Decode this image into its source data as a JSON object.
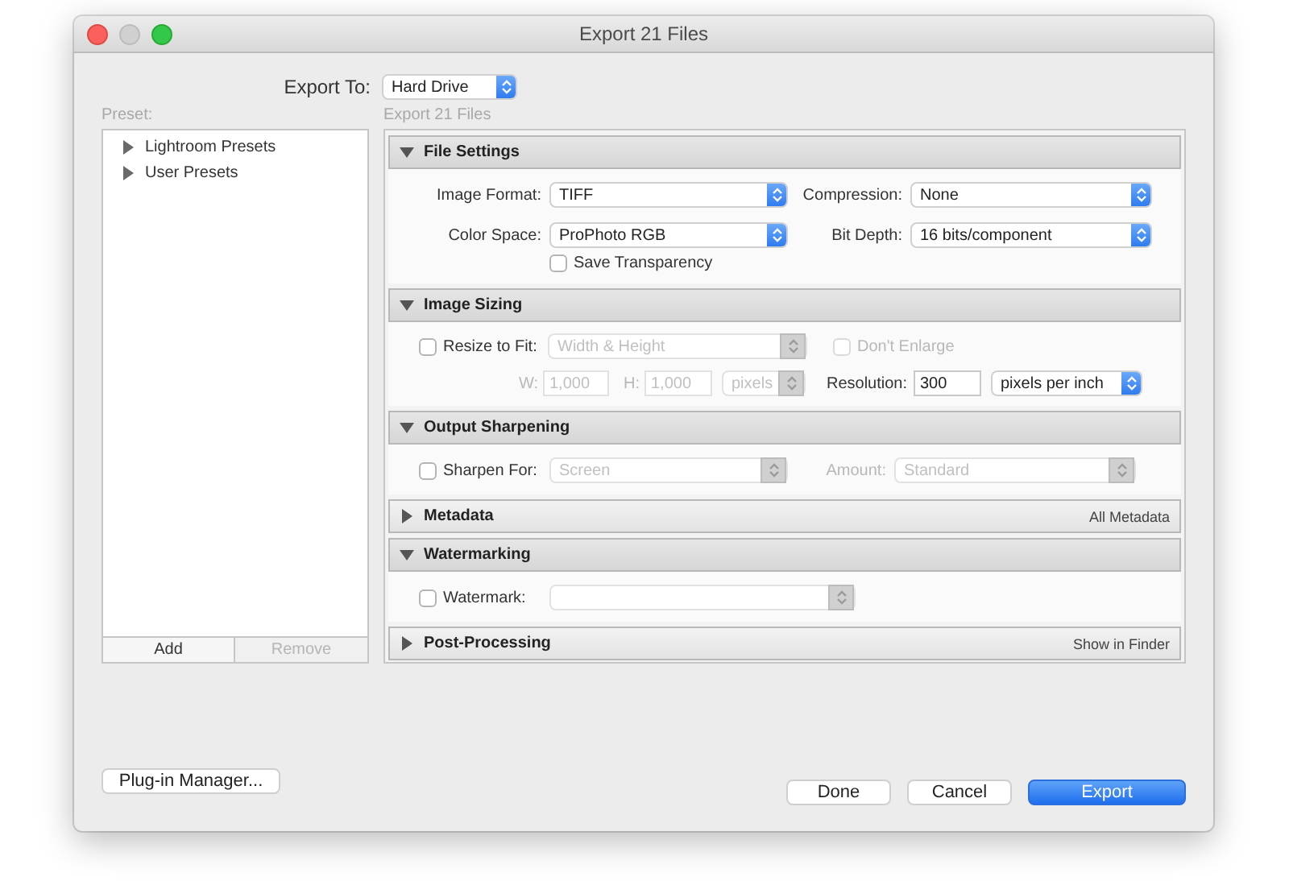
{
  "window": {
    "title": "Export 21 Files"
  },
  "export_to": {
    "label": "Export To:",
    "value": "Hard Drive"
  },
  "presets": {
    "label": "Preset:",
    "items": [
      {
        "label": "Lightroom Presets",
        "expanded": false
      },
      {
        "label": "User Presets",
        "expanded": false
      }
    ],
    "buttons": [
      {
        "label": "Add",
        "disabled": false
      },
      {
        "label": "Remove",
        "disabled": true
      }
    ]
  },
  "subtitle": "Export 21 Files",
  "file_settings": {
    "title": "File Settings",
    "expanded": true,
    "image_format": {
      "label": "Image Format:",
      "value": "TIFF"
    },
    "compression": {
      "label": "Compression:",
      "value": "None"
    },
    "color_space": {
      "label": "Color Space:",
      "value": "ProPhoto RGB"
    },
    "bit_depth": {
      "label": "Bit Depth:",
      "value": "16 bits/component"
    },
    "save_transparency": {
      "label": "Save Transparency",
      "checked": false
    }
  },
  "image_sizing": {
    "title": "Image Sizing",
    "expanded": true,
    "resize_to_fit": {
      "label": "Resize to Fit:",
      "checked": false
    },
    "resize_mode": {
      "value": "Width & Height",
      "disabled": true
    },
    "dont_enlarge": {
      "label": "Don't Enlarge",
      "checked": false,
      "disabled": true
    },
    "width": {
      "label": "W:",
      "value": "1,000",
      "disabled": true
    },
    "height": {
      "label": "H:",
      "value": "1,000",
      "disabled": true
    },
    "size_units": {
      "value": "pixels",
      "disabled": true
    },
    "resolution": {
      "label": "Resolution:",
      "value": "300"
    },
    "resolution_units": {
      "value": "pixels per inch",
      "disabled": false
    }
  },
  "output_sharpening": {
    "title": "Output Sharpening",
    "expanded": true,
    "sharpen_for": {
      "label": "Sharpen For:",
      "checked": false
    },
    "sharpen_target": {
      "value": "Screen",
      "disabled": true
    },
    "amount": {
      "label": "Amount:",
      "value": "Standard",
      "disabled": true
    }
  },
  "metadata": {
    "title": "Metadata",
    "expanded": false,
    "summary": "All Metadata"
  },
  "watermarking": {
    "title": "Watermarking",
    "expanded": true,
    "watermark": {
      "label": "Watermark:",
      "checked": false
    },
    "watermark_style": {
      "disabled": true
    }
  },
  "post_processing": {
    "title": "Post-Processing",
    "expanded": false,
    "summary": "Show in Finder"
  },
  "footer_buttons": [
    {
      "label": "Plug-in Manager...",
      "kind": "plain"
    },
    {
      "label": "Done",
      "kind": "plain"
    },
    {
      "label": "Cancel",
      "kind": "plain"
    },
    {
      "label": "Export",
      "kind": "primary"
    }
  ]
}
